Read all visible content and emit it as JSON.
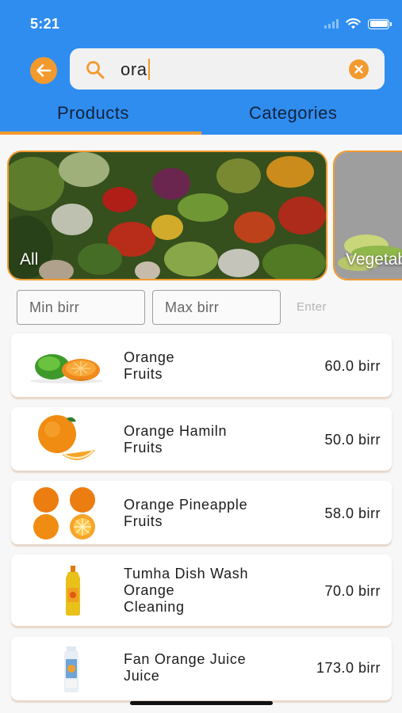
{
  "status_bar": {
    "time": "5:21"
  },
  "search": {
    "query": "ora"
  },
  "tabs": [
    {
      "label": "Products",
      "active": true
    },
    {
      "label": "Categories",
      "active": false
    }
  ],
  "categories": [
    {
      "label": "All"
    },
    {
      "label": "Vegetables"
    }
  ],
  "filters": {
    "min_placeholder": "Min birr",
    "max_placeholder": "Max birr",
    "enter_label": "Enter"
  },
  "products": [
    {
      "name": "Orange",
      "category": "Fruits",
      "price": "60.0 birr",
      "icon": "lime-and-orange-image"
    },
    {
      "name": "Orange Hamiln",
      "category": "Fruits",
      "price": "50.0 birr",
      "icon": "orange-slices-image"
    },
    {
      "name": "Orange Pineapple",
      "category": "Fruits",
      "price": "58.0 birr",
      "icon": "four-oranges-image"
    },
    {
      "name": "Tumha Dish Wash Orange",
      "category": "Cleaning",
      "price": "70.0 birr",
      "icon": "dish-wash-bottle-image"
    },
    {
      "name": "Fan Orange Juice",
      "category": "Juice",
      "price": "173.0 birr",
      "icon": "juice-bottle-image"
    }
  ],
  "colors": {
    "header": "#2f8df0",
    "accent": "#f39a2e",
    "background": "#f7f7f7"
  }
}
